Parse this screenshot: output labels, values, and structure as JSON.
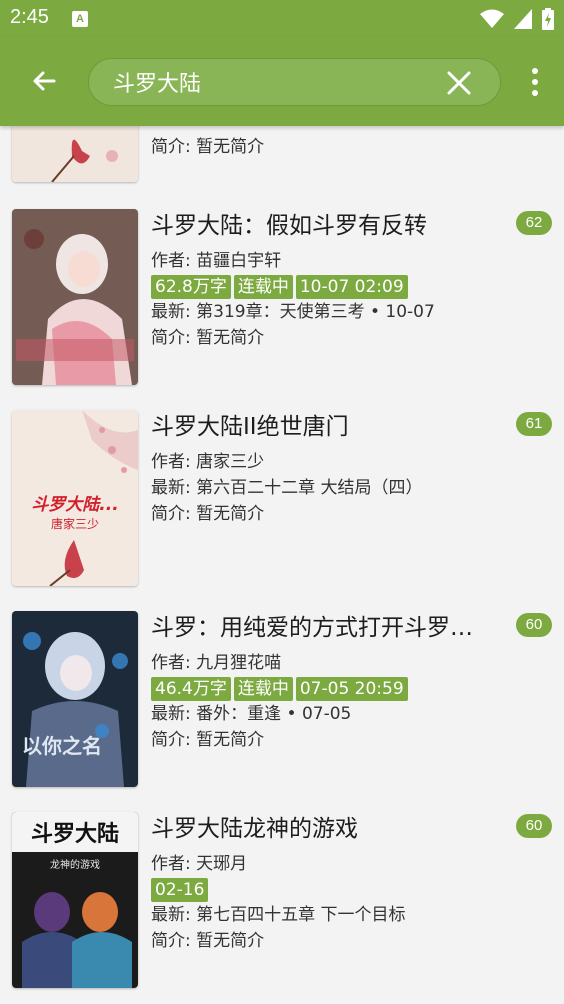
{
  "status": {
    "time": "2:45",
    "notif_label": "A"
  },
  "search": {
    "query": "斗罗大陆"
  },
  "partial_item": {
    "intro": "简介: 暂无简介"
  },
  "books": [
    {
      "title": "斗罗大陆：假如斗罗有反转",
      "count": "62",
      "author": "作者: 苗疆白宇轩",
      "tags": [
        "62.8万字",
        "连载中",
        "10-07 02:09"
      ],
      "latest": "最新: 第319章：天使第三考 • 10-07",
      "intro": "简介: 暂无简介"
    },
    {
      "title": "斗罗大陆II绝世唐门",
      "count": "61",
      "author": "作者: 唐家三少",
      "latest": "最新: 第六百二十二章 大结局（四）",
      "intro": "简介: 暂无简介",
      "cover_title": "斗罗大陆...",
      "cover_author": "唐家三少"
    },
    {
      "title": "斗罗：用纯爱的方式打开斗罗…",
      "count": "60",
      "author": "作者: 九月狸花喵",
      "tags": [
        "46.4万字",
        "连载中",
        "07-05 20:59"
      ],
      "latest": "最新: 番外：重逢 • 07-05",
      "intro": "简介: 暂无简介",
      "cover_text": "以你之名"
    },
    {
      "title": "斗罗大陆龙神的游戏",
      "count": "60",
      "author": "作者: 天琊月",
      "tags": [
        "02-16"
      ],
      "latest": "最新: 第七百四十五章 下一个目标",
      "intro": "简介: 暂无简介",
      "cover_title": "斗罗大陆",
      "cover_subtitle": "龙神的游戏"
    }
  ],
  "colors": {
    "primary": "#7caa40",
    "background": "#f3f3f3"
  },
  "icons": [
    "back-arrow-icon",
    "clear-icon",
    "more-vert-icon",
    "wifi-icon",
    "signal-icon",
    "battery-icon"
  ]
}
